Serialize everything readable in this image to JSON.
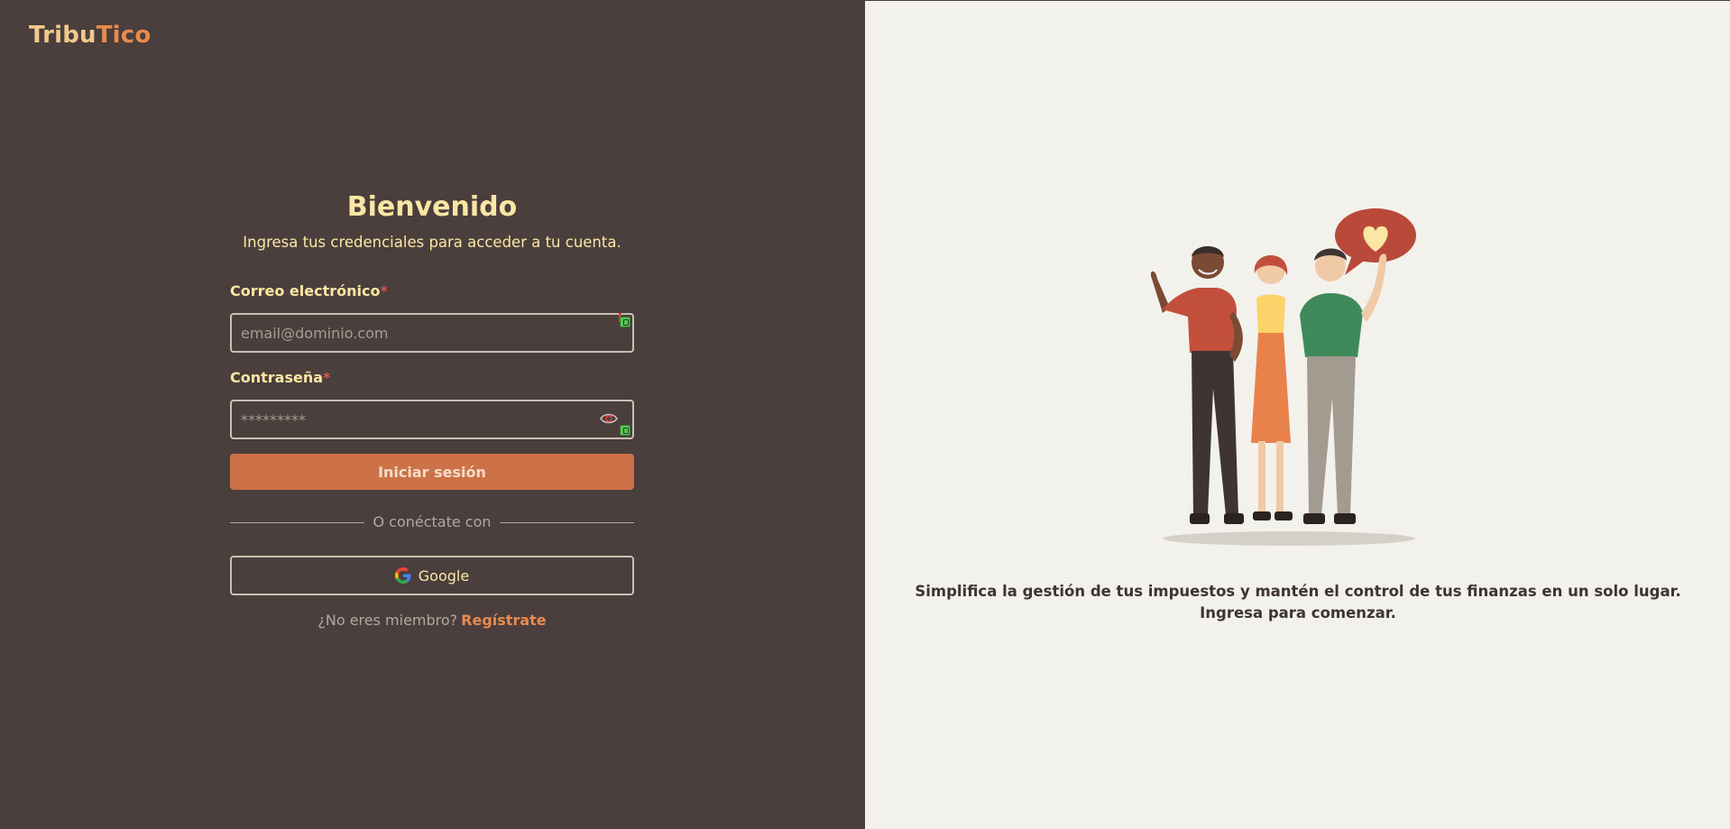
{
  "brand": {
    "part1": "Tribu",
    "part2": "Tico"
  },
  "login": {
    "title": "Bienvenido",
    "subtitle": "Ingresa tus credenciales para acceder a tu cuenta.",
    "email": {
      "label": "Correo electrónico",
      "required_mark": "*",
      "placeholder": "email@dominio.com",
      "value": ""
    },
    "password": {
      "label": "Contraseña",
      "required_mark": "*",
      "placeholder": "*********",
      "value": ""
    },
    "submit_label": "Iniciar sesión",
    "divider_text": "O conéctate con",
    "google_label": "Google",
    "signup_prompt": "¿No eres miembro?",
    "signup_link": "Regístrate"
  },
  "hero": {
    "caption": "Simplifica la gestión de tus impuestos y mantén el control de tus finanzas en un solo lugar. Ingresa para comenzar.",
    "illustration_icon": "three-people-waving-with-heart-bubble-illustration"
  },
  "colors": {
    "left_bg": "#4a3f3c",
    "right_bg": "#f3f1ec",
    "accent": "#cc7148",
    "heading": "#fbe7a3",
    "brand_primary": "#f2c98a",
    "brand_secondary": "#e98a4f"
  }
}
